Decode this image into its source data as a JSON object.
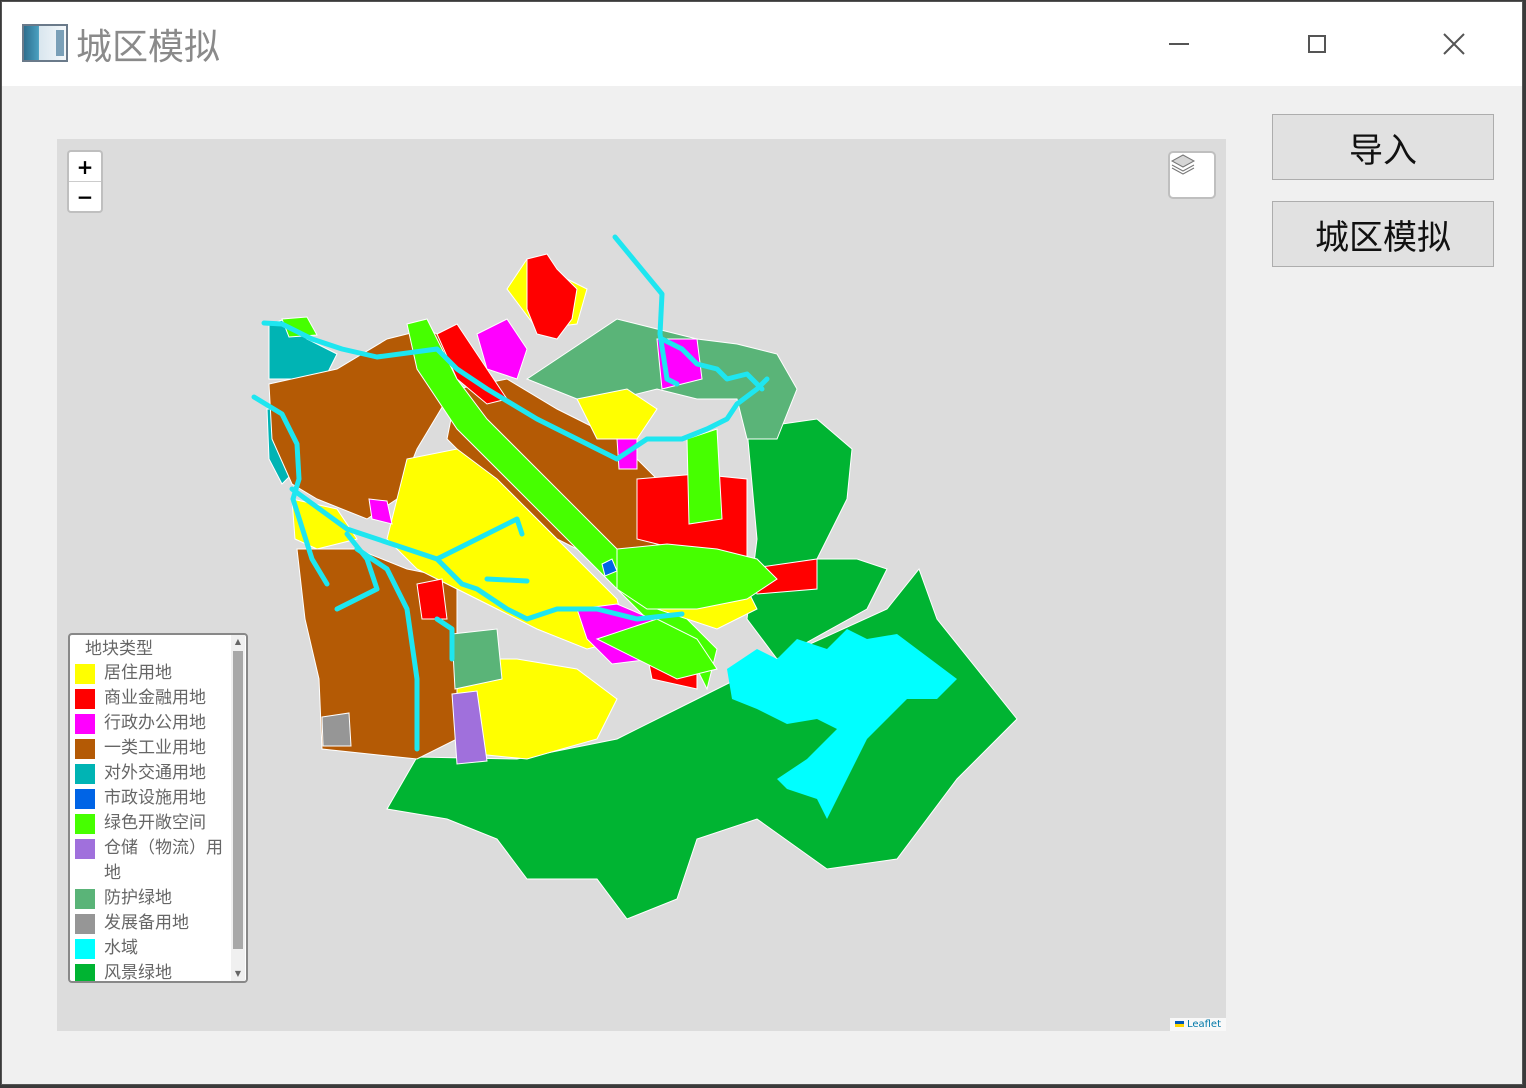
{
  "window": {
    "title": "城区模拟"
  },
  "buttons": {
    "import": "导入",
    "simulate": "城区模拟"
  },
  "map": {
    "zoom_in": "+",
    "zoom_out": "−",
    "attribution": "Leaflet",
    "legend": {
      "title": "地块类型",
      "items": [
        {
          "label": "居住用地",
          "color": "#ffff00"
        },
        {
          "label": "商业金融用地",
          "color": "#ff0000"
        },
        {
          "label": "行政办公用地",
          "color": "#ff00ff"
        },
        {
          "label": "一类工业用地",
          "color": "#b45a05"
        },
        {
          "label": "对外交通用地",
          "color": "#00b4b4"
        },
        {
          "label": "市政设施用地",
          "color": "#0064e6"
        },
        {
          "label": "绿色开敞空间",
          "color": "#46ff00"
        },
        {
          "label": "仓储（物流）用地",
          "color": "#a070dc"
        },
        {
          "label": "防护绿地",
          "color": "#5ab478"
        },
        {
          "label": "发展备用地",
          "color": "#969696"
        },
        {
          "label": "水域",
          "color": "#00ffff"
        },
        {
          "label": "风景绿地",
          "color": "#00b432"
        }
      ]
    }
  },
  "colors": {
    "water_line": "#1ee6f0",
    "map_background": "#dcdcdc"
  }
}
